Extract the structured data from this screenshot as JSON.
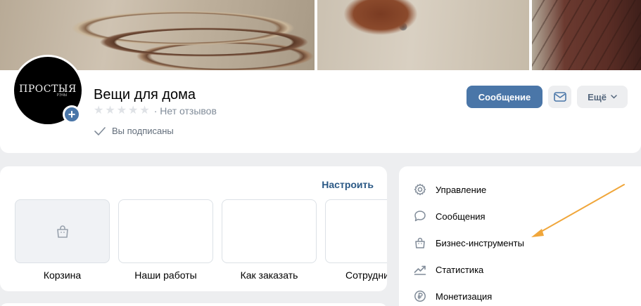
{
  "group": {
    "name": "Вещи для дома",
    "reviews_text": "Нет отзывов",
    "rating_stars": 0,
    "subscribed_text": "Вы подписаны",
    "avatar_text": "ПРОСТЫЯ",
    "avatar_subtext": "РЭЧЫ"
  },
  "actions": {
    "message_label": "Сообщение",
    "more_label": "Ещё"
  },
  "showcase": {
    "configure_label": "Настроить",
    "tiles": [
      {
        "label": "Корзина"
      },
      {
        "label": "Наши работы"
      },
      {
        "label": "Как заказать"
      },
      {
        "label": "Сотрудниче"
      }
    ]
  },
  "admin_menu": {
    "items": [
      {
        "label": "Управление",
        "icon": "gear-icon"
      },
      {
        "label": "Сообщения",
        "icon": "chat-bubble-icon"
      },
      {
        "label": "Бизнес-инструменты",
        "icon": "shopping-bag-icon"
      },
      {
        "label": "Статистика",
        "icon": "chart-trend-icon"
      },
      {
        "label": "Монетизация",
        "icon": "ruble-coin-icon"
      }
    ]
  },
  "colors": {
    "accent": "#4a76a8",
    "link": "#2a5885",
    "annotation_arrow": "#f0a63a",
    "background": "#edeef0"
  }
}
